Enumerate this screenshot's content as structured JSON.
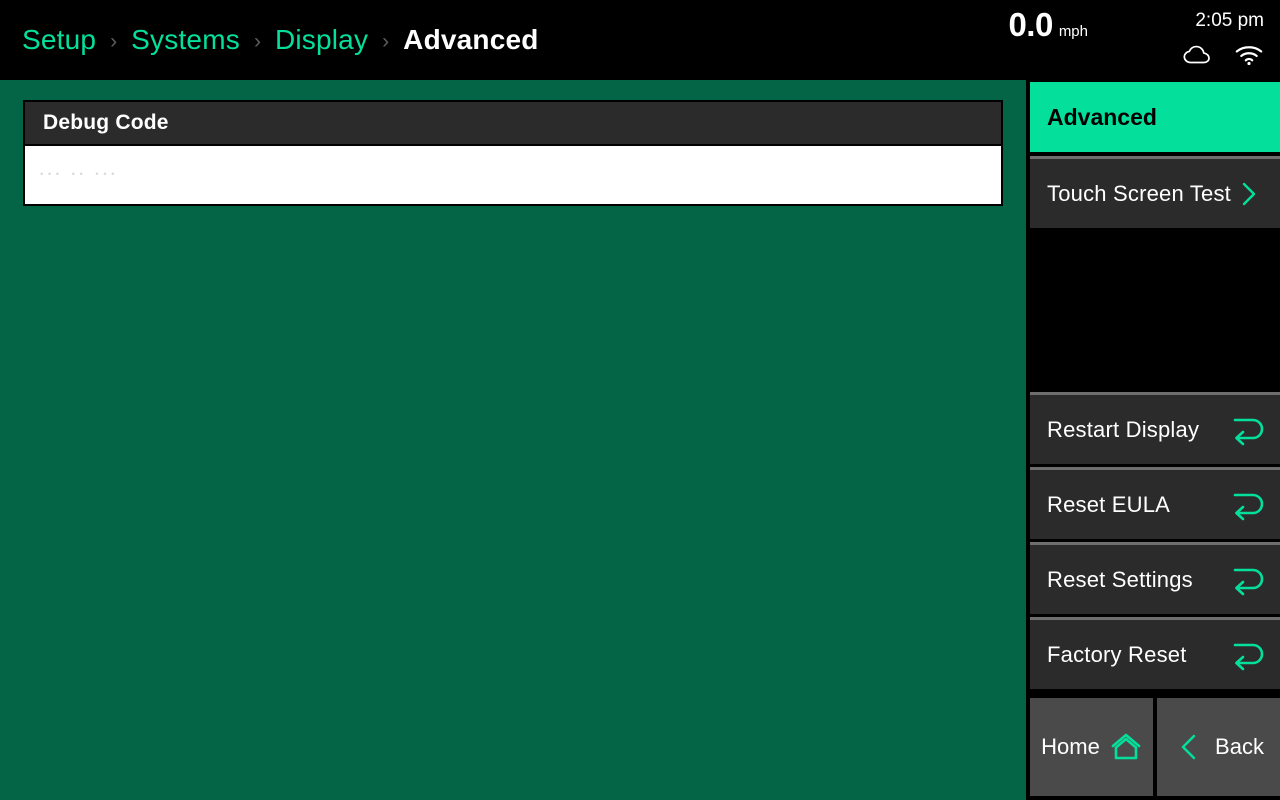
{
  "theme": {
    "accent_green": "#04e09b",
    "content_green": "#046446",
    "panel_dark": "#2b2b2b",
    "nav_gray": "#4a4a4a",
    "background_black": "#000000"
  },
  "topbar": {
    "breadcrumb": [
      {
        "label": "Setup",
        "current": false
      },
      {
        "label": "Systems",
        "current": false
      },
      {
        "label": "Display",
        "current": false
      },
      {
        "label": "Advanced",
        "current": true
      }
    ],
    "separator": "›",
    "speed": {
      "value": "0.0",
      "unit": "mph"
    },
    "clock": "2:05 pm",
    "icons": [
      "cloud-icon",
      "wifi-icon"
    ]
  },
  "content": {
    "debug_panel": {
      "title": "Debug Code",
      "input_placeholder": "••• •• •••",
      "input_value": ""
    }
  },
  "sidebar": {
    "header": {
      "label": "Advanced"
    },
    "items": [
      {
        "label": "Touch Screen Test",
        "icon": "chevron-right-icon"
      },
      {
        "label": "Restart Display",
        "icon": "restart-loop-icon"
      },
      {
        "label": "Reset EULA",
        "icon": "restart-loop-icon"
      },
      {
        "label": "Reset Settings",
        "icon": "restart-loop-icon"
      },
      {
        "label": "Factory Reset",
        "icon": "restart-loop-icon"
      }
    ],
    "nav": {
      "home": {
        "label": "Home",
        "icon": "home-icon"
      },
      "back": {
        "label": "Back",
        "icon": "chevron-left-icon"
      }
    }
  }
}
